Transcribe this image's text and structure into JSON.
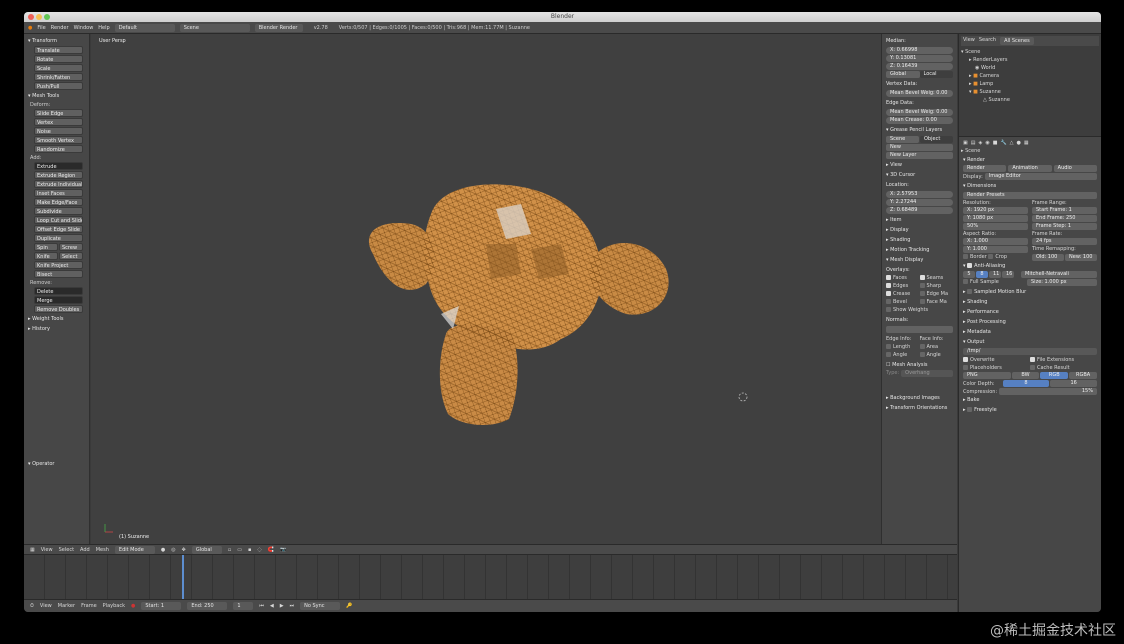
{
  "window": {
    "title": "Blender"
  },
  "infobar": {
    "menus": [
      "File",
      "Render",
      "Window",
      "Help"
    ],
    "layout": "Default",
    "scene": "Scene",
    "engine": "Blender Render",
    "version": "v2.78",
    "stats": "Verts:0/507 | Edges:0/1005 | Faces:0/500 | Tris:968 | Mem:11.77M | Suzanne"
  },
  "toolshelf": {
    "transform_header": "Transform",
    "transform": [
      "Translate",
      "Rotate",
      "Scale",
      "Shrink/Fatten",
      "Push/Pull"
    ],
    "mesh_tools_header": "Mesh Tools",
    "deform_label": "Deform:",
    "deform": [
      "Slide Edge",
      "Vertex",
      "Noise",
      "Smooth Vertex",
      "Randomize"
    ],
    "add_label": "Add:",
    "add": [
      "Extrude",
      "Extrude Region",
      "Extrude Individual",
      "Inset Faces",
      "Make Edge/Face",
      "Subdivide",
      "Loop Cut and Slide",
      "Offset Edge Slide",
      "Duplicate"
    ],
    "spin": "Spin",
    "screw": "Screw",
    "knife": "Knife",
    "select": "Select",
    "knife_project": "Knife Project",
    "bisect": "Bisect",
    "remove_label": "Remove:",
    "delete": "Delete",
    "merge": "Merge",
    "remove_doubles": "Remove Doubles",
    "weight_tools": "Weight Tools",
    "history": "History",
    "operator": "Operator"
  },
  "viewport": {
    "label": "User Persp",
    "object": "(1) Suzanne"
  },
  "npanel": {
    "median": "Median:",
    "x": "X: 0.66998",
    "y": "Y: 0.13081",
    "z": "Z: 0.16439",
    "global": "Global",
    "local": "Local",
    "vertex_data": "Vertex Data:",
    "bevel_weight": "Mean Bevel Weig: 0.00",
    "edge_data": "Edge Data:",
    "edge_bevel": "Mean Bevel Weig: 0.00",
    "crease": "Mean Crease: 0.00",
    "grease_pencil": "Grease Pencil Layers",
    "scene": "Scene",
    "object": "Object",
    "new": "New",
    "new_layer": "New Layer",
    "view": "View",
    "cursor": "3D Cursor",
    "location": "Location:",
    "cx": "X: 2.57953",
    "cy": "Y: 2.27244",
    "cz": "Z: 0.68489",
    "item": "Item",
    "display": "Display",
    "shading": "Shading",
    "motion": "Motion Tracking",
    "mesh_display": "Mesh Display",
    "overlays": "Overlays:",
    "faces": "Faces",
    "seams": "Seams",
    "edges": "Edges",
    "sharp": "Sharp",
    "crease2": "Crease",
    "edge_ma": "Edge Ma",
    "bevel": "Bevel",
    "face_ma": "Face Ma",
    "show_weights": "Show Weights",
    "normals": "Normals:",
    "edge_info": "Edge Info:",
    "face_info": "Face Info:",
    "length": "Length",
    "area": "Area",
    "angle": "Angle",
    "angle2": "Angle",
    "mesh_analysis": "Mesh Analysis",
    "type": "Type:",
    "overhang": "Overhang",
    "bg_images": "Background Images",
    "transform_orient": "Transform Orientations"
  },
  "outliner": {
    "view": "View",
    "search": "Search",
    "scenes": "All Scenes",
    "items": [
      "Scene",
      "RenderLayers",
      "World",
      "Camera",
      "Lamp",
      "Suzanne",
      "Suzanne"
    ]
  },
  "props": {
    "scene": "Scene",
    "render": "Render",
    "tab_render": "Render",
    "tab_animation": "Animation",
    "tab_audio": "Audio",
    "display": "Display:",
    "image_editor": "Image Editor",
    "dimensions": "Dimensions",
    "presets": "Render Presets",
    "resolution": "Resolution:",
    "frame_range": "Frame Range:",
    "res_x": "X: 1920 px",
    "res_y": "Y: 1080 px",
    "pct": "50%",
    "start": "Start Frame: 1",
    "end": "End Frame: 250",
    "step": "Frame Step: 1",
    "aspect": "Aspect Ratio:",
    "frame_rate": "Frame Rate:",
    "ax": "X: 1.000",
    "ay": "Y: 1.000",
    "fps": "24 fps",
    "time_remap": "Time Remapping:",
    "border": "Border",
    "crop": "Crop",
    "old": "Old: 100",
    "newv": "New: 100",
    "aa": "Anti-Aliasing",
    "aa_vals": [
      "5",
      "8",
      "11",
      "16"
    ],
    "filter": "Mitchell-Netravali",
    "full_sample": "Full Sample",
    "size": "Size: 1.000 px",
    "sampled_mb": "Sampled Motion Blur",
    "shading": "Shading",
    "performance": "Performance",
    "post": "Post Processing",
    "metadata": "Metadata",
    "output": "Output",
    "path": "/tmp/",
    "overwrite": "Overwrite",
    "file_ext": "File Extensions",
    "placeholders": "Placeholders",
    "cache_result": "Cache Result",
    "png": "PNG",
    "bw": "BW",
    "rgb": "RGB",
    "rgba": "RGBA",
    "color_depth": "Color Depth:",
    "depth": "8",
    "depth16": "16",
    "compression": "Compression:",
    "comp_val": "15%",
    "bake": "Bake",
    "freestyle": "Freestyle"
  },
  "vheader": {
    "menus": [
      "View",
      "Select",
      "Add",
      "Mesh"
    ],
    "mode": "Edit Mode",
    "orientation": "Global"
  },
  "tl_header": {
    "menus": [
      "View",
      "Marker",
      "Frame",
      "Playback"
    ],
    "start": "Start: 1",
    "end": "End: 250",
    "frame": "1",
    "sync": "No Sync"
  },
  "watermark": "@稀土掘金技术社区"
}
